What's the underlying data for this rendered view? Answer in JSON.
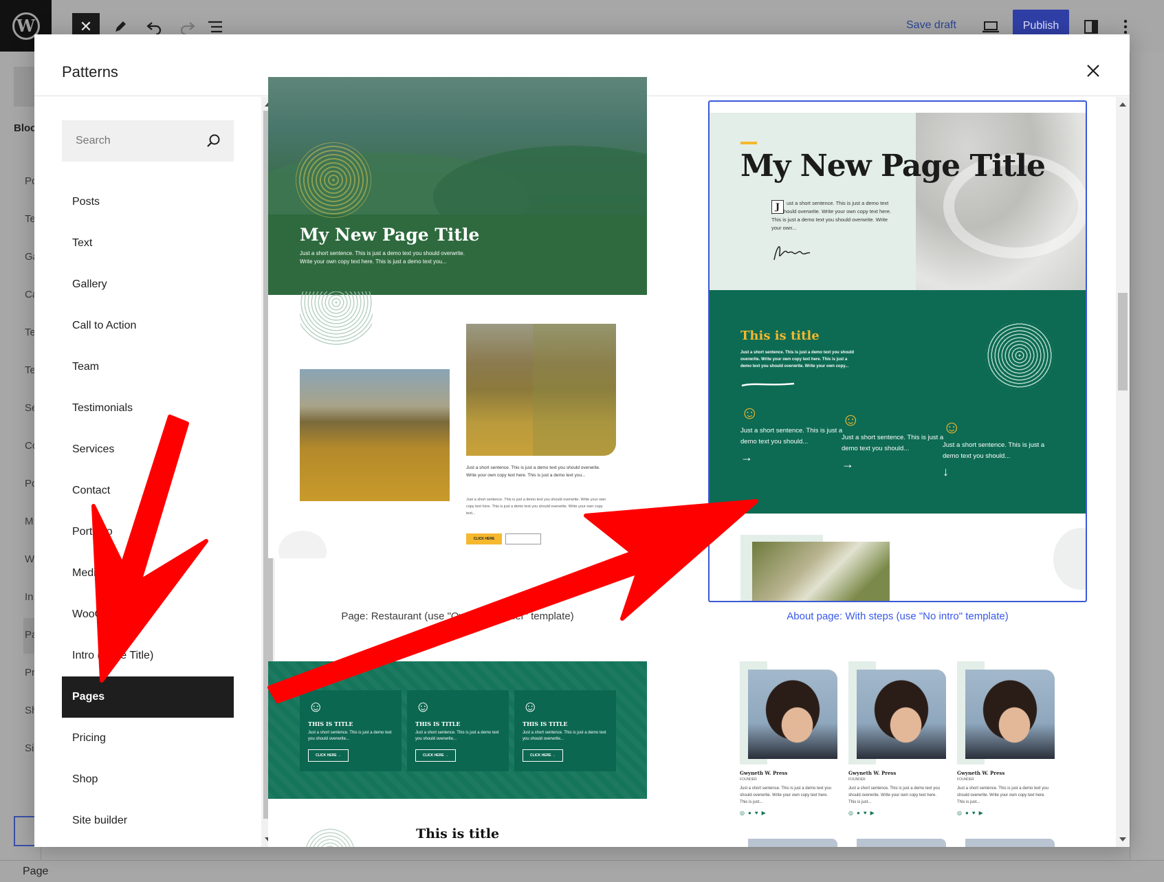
{
  "toolbar": {
    "save_draft": "Save draft",
    "publish": "Publish"
  },
  "editor_sidebar": {
    "block_label": "Bloc",
    "ghost_items": [
      "Po",
      "Te",
      "Ga",
      "Ca",
      "Te",
      "Te",
      "Se",
      "Co",
      "Po",
      "M",
      "W",
      "In",
      "Pa",
      "Pr",
      "Sh",
      "Si"
    ]
  },
  "status_bar": {
    "breadcrumb": "Page"
  },
  "modal": {
    "title": "Patterns",
    "search_placeholder": "Search",
    "categories": [
      {
        "label": "Posts",
        "active": false
      },
      {
        "label": "Text",
        "active": false
      },
      {
        "label": "Gallery",
        "active": false
      },
      {
        "label": "Call to Action",
        "active": false
      },
      {
        "label": "Team",
        "active": false
      },
      {
        "label": "Testimonials",
        "active": false
      },
      {
        "label": "Services",
        "active": false
      },
      {
        "label": "Contact",
        "active": false
      },
      {
        "label": "Portfolio",
        "active": false
      },
      {
        "label": "Media",
        "active": false
      },
      {
        "label": "WooCommerce",
        "active": false
      },
      {
        "label": "Intro (Page Title)",
        "active": false
      },
      {
        "label": "Pages",
        "active": true
      },
      {
        "label": "Pricing",
        "active": false
      },
      {
        "label": "Shop",
        "active": false
      },
      {
        "label": "Site builder",
        "active": false
      }
    ]
  },
  "patterns": {
    "card1": {
      "caption": "Page: Restaurant (use \"Overlaid header\" template)",
      "hero_title": "My New Page Title",
      "hero_sub": "Just a short sentence. This is just a demo text you should overwrite. Write your own copy text here. This is just a demo text you...",
      "body_text": "Just a short sentence. This is just a demo text you should overwrite. Write your own copy text here. This is just a demo text you...",
      "body_text_small": "Just a short sentence. This is just a demo text you should overwrite. Write your own copy text here. This is just a demo text you should overwrite. Write your own copy text...",
      "button": "CLICK HERE"
    },
    "card2": {
      "caption": "About page: With steps (use \"No intro\" template)",
      "title": "My New Page Title",
      "dropcap": "J",
      "intro": "ust a short sentence. This is just a demo text you should overwrite. Write your own copy text here. This is just a demo text you should overwrite. Write your own...",
      "section_title": "This is title",
      "section_desc": "Just a short sentence. This is just a demo text you should overwrite. Write your own copy text here. This is just a demo text you should overwrite. Write your own copy...",
      "steps": [
        {
          "text": "Just a short sentence. This is just a demo text you should...",
          "arrow": "→"
        },
        {
          "text": "Just a short sentence. This is just a demo text you should...",
          "arrow": "→"
        },
        {
          "text": "Just a short sentence. This is just a demo text you should...",
          "arrow": "↓"
        }
      ]
    },
    "card3": {
      "boxes": [
        {
          "title": "THIS IS TITLE",
          "text": "Just a short sentence. This is just a demo text you should overwrite...",
          "button": "CLICK HERE →"
        },
        {
          "title": "THIS IS TITLE",
          "text": "Just a short sentence. This is just a demo text you should overwrite...",
          "button": "CLICK HERE →"
        },
        {
          "title": "THIS IS TITLE",
          "text": "Just a short sentence. This is just a demo text you should overwrite...",
          "button": "CLICK HERE →"
        }
      ],
      "section_title": "This is title"
    },
    "card4": {
      "members": [
        {
          "name": "Gwyneth W. Press",
          "role": "FOUNDER",
          "bio": "Just a short sentence. This is just a demo text you should overwrite. Write your own copy text here. This is just..."
        },
        {
          "name": "Gwyneth W. Press",
          "role": "FOUNDER",
          "bio": "Just a short sentence. This is just a demo text you should overwrite. Write your own copy text here. This is just..."
        },
        {
          "name": "Gwyneth W. Press",
          "role": "FOUNDER",
          "bio": "Just a short sentence. This is just a demo text you should overwrite. Write your own copy text here. This is just..."
        }
      ],
      "social_icons": "◎●♥▶"
    }
  },
  "colors": {
    "accent": "#3a58d6",
    "publish": "#2f3fa6",
    "pattern_green": "#0d6b53",
    "pattern_yellow": "#f5b82e",
    "annotation_red": "#ff0000"
  }
}
